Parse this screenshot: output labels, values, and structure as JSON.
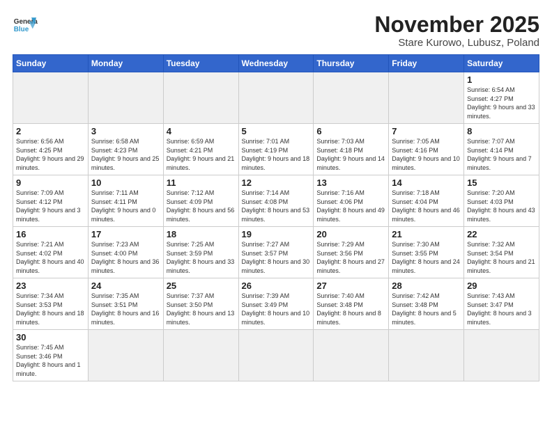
{
  "header": {
    "logo_general": "General",
    "logo_blue": "Blue",
    "month_title": "November 2025",
    "location": "Stare Kurowo, Lubusz, Poland"
  },
  "weekdays": [
    "Sunday",
    "Monday",
    "Tuesday",
    "Wednesday",
    "Thursday",
    "Friday",
    "Saturday"
  ],
  "weeks": [
    [
      {
        "day": "",
        "info": "",
        "empty": true
      },
      {
        "day": "",
        "info": "",
        "empty": true
      },
      {
        "day": "",
        "info": "",
        "empty": true
      },
      {
        "day": "",
        "info": "",
        "empty": true
      },
      {
        "day": "",
        "info": "",
        "empty": true
      },
      {
        "day": "",
        "info": "",
        "empty": true
      },
      {
        "day": "1",
        "info": "Sunrise: 6:54 AM\nSunset: 4:27 PM\nDaylight: 9 hours\nand 33 minutes."
      }
    ],
    [
      {
        "day": "2",
        "info": "Sunrise: 6:56 AM\nSunset: 4:25 PM\nDaylight: 9 hours\nand 29 minutes."
      },
      {
        "day": "3",
        "info": "Sunrise: 6:58 AM\nSunset: 4:23 PM\nDaylight: 9 hours\nand 25 minutes."
      },
      {
        "day": "4",
        "info": "Sunrise: 6:59 AM\nSunset: 4:21 PM\nDaylight: 9 hours\nand 21 minutes."
      },
      {
        "day": "5",
        "info": "Sunrise: 7:01 AM\nSunset: 4:19 PM\nDaylight: 9 hours\nand 18 minutes."
      },
      {
        "day": "6",
        "info": "Sunrise: 7:03 AM\nSunset: 4:18 PM\nDaylight: 9 hours\nand 14 minutes."
      },
      {
        "day": "7",
        "info": "Sunrise: 7:05 AM\nSunset: 4:16 PM\nDaylight: 9 hours\nand 10 minutes."
      },
      {
        "day": "8",
        "info": "Sunrise: 7:07 AM\nSunset: 4:14 PM\nDaylight: 9 hours\nand 7 minutes."
      }
    ],
    [
      {
        "day": "9",
        "info": "Sunrise: 7:09 AM\nSunset: 4:12 PM\nDaylight: 9 hours\nand 3 minutes."
      },
      {
        "day": "10",
        "info": "Sunrise: 7:11 AM\nSunset: 4:11 PM\nDaylight: 9 hours\nand 0 minutes."
      },
      {
        "day": "11",
        "info": "Sunrise: 7:12 AM\nSunset: 4:09 PM\nDaylight: 8 hours\nand 56 minutes."
      },
      {
        "day": "12",
        "info": "Sunrise: 7:14 AM\nSunset: 4:08 PM\nDaylight: 8 hours\nand 53 minutes."
      },
      {
        "day": "13",
        "info": "Sunrise: 7:16 AM\nSunset: 4:06 PM\nDaylight: 8 hours\nand 49 minutes."
      },
      {
        "day": "14",
        "info": "Sunrise: 7:18 AM\nSunset: 4:04 PM\nDaylight: 8 hours\nand 46 minutes."
      },
      {
        "day": "15",
        "info": "Sunrise: 7:20 AM\nSunset: 4:03 PM\nDaylight: 8 hours\nand 43 minutes."
      }
    ],
    [
      {
        "day": "16",
        "info": "Sunrise: 7:21 AM\nSunset: 4:02 PM\nDaylight: 8 hours\nand 40 minutes."
      },
      {
        "day": "17",
        "info": "Sunrise: 7:23 AM\nSunset: 4:00 PM\nDaylight: 8 hours\nand 36 minutes."
      },
      {
        "day": "18",
        "info": "Sunrise: 7:25 AM\nSunset: 3:59 PM\nDaylight: 8 hours\nand 33 minutes."
      },
      {
        "day": "19",
        "info": "Sunrise: 7:27 AM\nSunset: 3:57 PM\nDaylight: 8 hours\nand 30 minutes."
      },
      {
        "day": "20",
        "info": "Sunrise: 7:29 AM\nSunset: 3:56 PM\nDaylight: 8 hours\nand 27 minutes."
      },
      {
        "day": "21",
        "info": "Sunrise: 7:30 AM\nSunset: 3:55 PM\nDaylight: 8 hours\nand 24 minutes."
      },
      {
        "day": "22",
        "info": "Sunrise: 7:32 AM\nSunset: 3:54 PM\nDaylight: 8 hours\nand 21 minutes."
      }
    ],
    [
      {
        "day": "23",
        "info": "Sunrise: 7:34 AM\nSunset: 3:53 PM\nDaylight: 8 hours\nand 18 minutes."
      },
      {
        "day": "24",
        "info": "Sunrise: 7:35 AM\nSunset: 3:51 PM\nDaylight: 8 hours\nand 16 minutes."
      },
      {
        "day": "25",
        "info": "Sunrise: 7:37 AM\nSunset: 3:50 PM\nDaylight: 8 hours\nand 13 minutes."
      },
      {
        "day": "26",
        "info": "Sunrise: 7:39 AM\nSunset: 3:49 PM\nDaylight: 8 hours\nand 10 minutes."
      },
      {
        "day": "27",
        "info": "Sunrise: 7:40 AM\nSunset: 3:48 PM\nDaylight: 8 hours\nand 8 minutes."
      },
      {
        "day": "28",
        "info": "Sunrise: 7:42 AM\nSunset: 3:48 PM\nDaylight: 8 hours\nand 5 minutes."
      },
      {
        "day": "29",
        "info": "Sunrise: 7:43 AM\nSunset: 3:47 PM\nDaylight: 8 hours\nand 3 minutes."
      }
    ],
    [
      {
        "day": "30",
        "info": "Sunrise: 7:45 AM\nSunset: 3:46 PM\nDaylight: 8 hours\nand 1 minute."
      },
      {
        "day": "",
        "info": "",
        "empty": true
      },
      {
        "day": "",
        "info": "",
        "empty": true
      },
      {
        "day": "",
        "info": "",
        "empty": true
      },
      {
        "day": "",
        "info": "",
        "empty": true
      },
      {
        "day": "",
        "info": "",
        "empty": true
      },
      {
        "day": "",
        "info": "",
        "empty": true
      }
    ]
  ]
}
